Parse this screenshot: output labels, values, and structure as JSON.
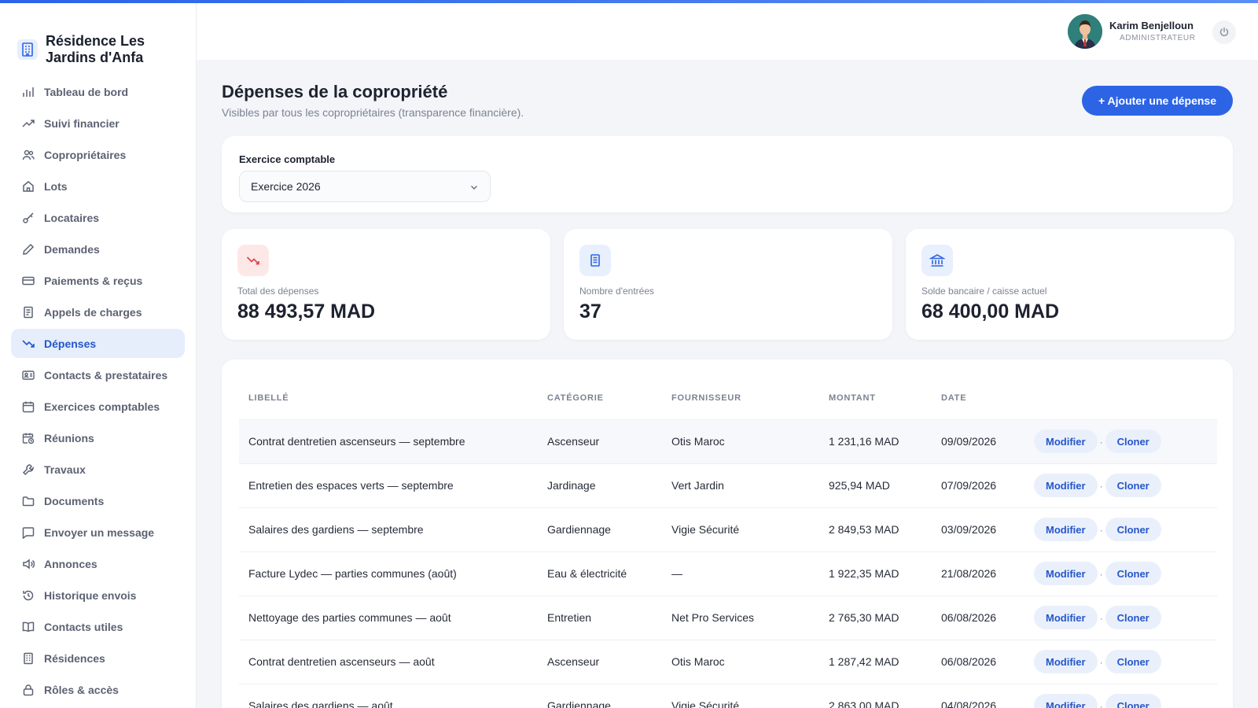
{
  "brand": {
    "name": "Résidence Les Jardins d'Anfa",
    "icon": "building-icon"
  },
  "sidebar": {
    "items": [
      {
        "label": "Tableau de bord",
        "icon": "bar-chart-icon"
      },
      {
        "label": "Suivi financier",
        "icon": "trend-up-icon"
      },
      {
        "label": "Copropriétaires",
        "icon": "users-icon"
      },
      {
        "label": "Lots",
        "icon": "home-icon"
      },
      {
        "label": "Locataires",
        "icon": "key-icon"
      },
      {
        "label": "Demandes",
        "icon": "pencil-icon"
      },
      {
        "label": "Paiements & reçus",
        "icon": "credit-card-icon"
      },
      {
        "label": "Appels de charges",
        "icon": "receipt-icon"
      },
      {
        "label": "Dépenses",
        "icon": "trend-down-icon",
        "active": true
      },
      {
        "label": "Contacts & prestataires",
        "icon": "id-card-icon"
      },
      {
        "label": "Exercices comptables",
        "icon": "calendar-icon"
      },
      {
        "label": "Réunions",
        "icon": "calendar-clock-icon"
      },
      {
        "label": "Travaux",
        "icon": "wrench-icon"
      },
      {
        "label": "Documents",
        "icon": "folder-icon"
      },
      {
        "label": "Envoyer un message",
        "icon": "message-icon"
      },
      {
        "label": "Annonces",
        "icon": "megaphone-icon"
      },
      {
        "label": "Historique envois",
        "icon": "history-icon"
      },
      {
        "label": "Contacts utiles",
        "icon": "book-icon"
      },
      {
        "label": "Résidences",
        "icon": "building-icon"
      },
      {
        "label": "Rôles & accès",
        "icon": "lock-icon"
      }
    ]
  },
  "header": {
    "user_name": "Karim Benjelloun",
    "user_role": "ADMINISTRATEUR",
    "power_icon": "power-icon"
  },
  "page": {
    "title": "Dépenses de la copropriété",
    "subtitle": "Visibles par tous les copropriétaires (transparence financière).",
    "add_button": "+ Ajouter une dépense"
  },
  "filter": {
    "label": "Exercice comptable",
    "value": "Exercice 2026"
  },
  "stats": [
    {
      "label": "Total des dépenses",
      "value": "88 493,57 MAD",
      "icon": "trend-down-icon",
      "color": "#e04848"
    },
    {
      "label": "Nombre d'entrées",
      "value": "37",
      "icon": "receipt-icon",
      "color": "#2d64e6"
    },
    {
      "label": "Solde bancaire / caisse actuel",
      "value": "68 400,00 MAD",
      "icon": "bank-icon",
      "color": "#2d64e6"
    }
  ],
  "table": {
    "headers": [
      "LIBELLÉ",
      "CATÉGORIE",
      "FOURNISSEUR",
      "MONTANT",
      "DATE"
    ],
    "modify_label": "Modifier",
    "clone_label": "Cloner",
    "separator": "·",
    "rows": [
      [
        "Contrat dentretien ascenseurs — septembre",
        "Ascenseur",
        "Otis Maroc",
        "1 231,16 MAD",
        "09/09/2026"
      ],
      [
        "Entretien des espaces verts — septembre",
        "Jardinage",
        "Vert Jardin",
        "925,94 MAD",
        "07/09/2026"
      ],
      [
        "Salaires des gardiens — septembre",
        "Gardiennage",
        "Vigie Sécurité",
        "2 849,53 MAD",
        "03/09/2026"
      ],
      [
        "Facture Lydec — parties communes (août)",
        "Eau & électricité",
        "—",
        "1 922,35 MAD",
        "21/08/2026"
      ],
      [
        "Nettoyage des parties communes — août",
        "Entretien",
        "Net Pro Services",
        "2 765,30 MAD",
        "06/08/2026"
      ],
      [
        "Contrat dentretien ascenseurs — août",
        "Ascenseur",
        "Otis Maroc",
        "1 287,42 MAD",
        "06/08/2026"
      ],
      [
        "Salaires des gardiens — août",
        "Gardiennage",
        "Vigie Sécurité",
        "2 863,00 MAD",
        "04/08/2026"
      ]
    ]
  },
  "colors": {
    "accent": "#2d64e6",
    "active_bg": "#e6eefc",
    "danger": "#e04848"
  }
}
